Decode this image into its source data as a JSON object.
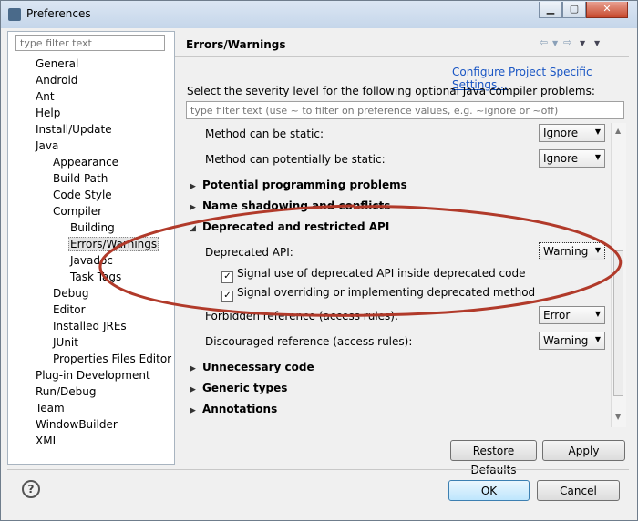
{
  "window": {
    "title": "Preferences"
  },
  "left": {
    "filter_placeholder": "type filter text",
    "tree": [
      {
        "label": "General",
        "level": 0
      },
      {
        "label": "Android",
        "level": 0
      },
      {
        "label": "Ant",
        "level": 0
      },
      {
        "label": "Help",
        "level": 0
      },
      {
        "label": "Install/Update",
        "level": 0
      },
      {
        "label": "Java",
        "level": 0
      },
      {
        "label": "Appearance",
        "level": 1
      },
      {
        "label": "Build Path",
        "level": 1
      },
      {
        "label": "Code Style",
        "level": 1
      },
      {
        "label": "Compiler",
        "level": 1
      },
      {
        "label": "Building",
        "level": 2
      },
      {
        "label": "Errors/Warnings",
        "level": 2,
        "selected": true
      },
      {
        "label": "Javadoc",
        "level": 2
      },
      {
        "label": "Task Tags",
        "level": 2
      },
      {
        "label": "Debug",
        "level": 1
      },
      {
        "label": "Editor",
        "level": 1
      },
      {
        "label": "Installed JREs",
        "level": 1
      },
      {
        "label": "JUnit",
        "level": 1
      },
      {
        "label": "Properties Files Editor",
        "level": 1
      },
      {
        "label": "Plug-in Development",
        "level": 0
      },
      {
        "label": "Run/Debug",
        "level": 0
      },
      {
        "label": "Team",
        "level": 0
      },
      {
        "label": "WindowBuilder",
        "level": 0
      },
      {
        "label": "XML",
        "level": 0
      }
    ]
  },
  "right": {
    "title": "Errors/Warnings",
    "configure_link": "Configure Project Specific Settings...",
    "description": "Select the severity level for the following optional Java compiler problems:",
    "filter_placeholder": "type filter text (use ~ to filter on preference values, e.g. ~ignore or ~off)",
    "rows": {
      "static": {
        "label": "Method can be static:",
        "value": "Ignore"
      },
      "potentially_static": {
        "label": "Method can potentially be static:",
        "value": "Ignore"
      },
      "deprecated_api": {
        "label": "Deprecated API:",
        "value": "Warning"
      },
      "forbidden": {
        "label": "Forbidden reference (access rules):",
        "value": "Error"
      },
      "discouraged": {
        "label": "Discouraged reference (access rules):",
        "value": "Warning"
      }
    },
    "sections": {
      "potential": "Potential programming problems",
      "shadowing": "Name shadowing and conflicts",
      "deprecated": "Deprecated and restricted API",
      "unnecessary": "Unnecessary code",
      "generic": "Generic types",
      "annotations": "Annotations"
    },
    "checks": {
      "signal_inside": {
        "label": "Signal use of deprecated API inside deprecated code",
        "checked": true
      },
      "signal_override": {
        "label": "Signal overriding or implementing deprecated method",
        "checked": true
      }
    },
    "restore_defaults": "Restore Defaults",
    "apply": "Apply"
  },
  "footer": {
    "ok": "OK",
    "cancel": "Cancel"
  },
  "colors": {
    "link": "#1a56c4",
    "annotation": "#b13a2a"
  }
}
